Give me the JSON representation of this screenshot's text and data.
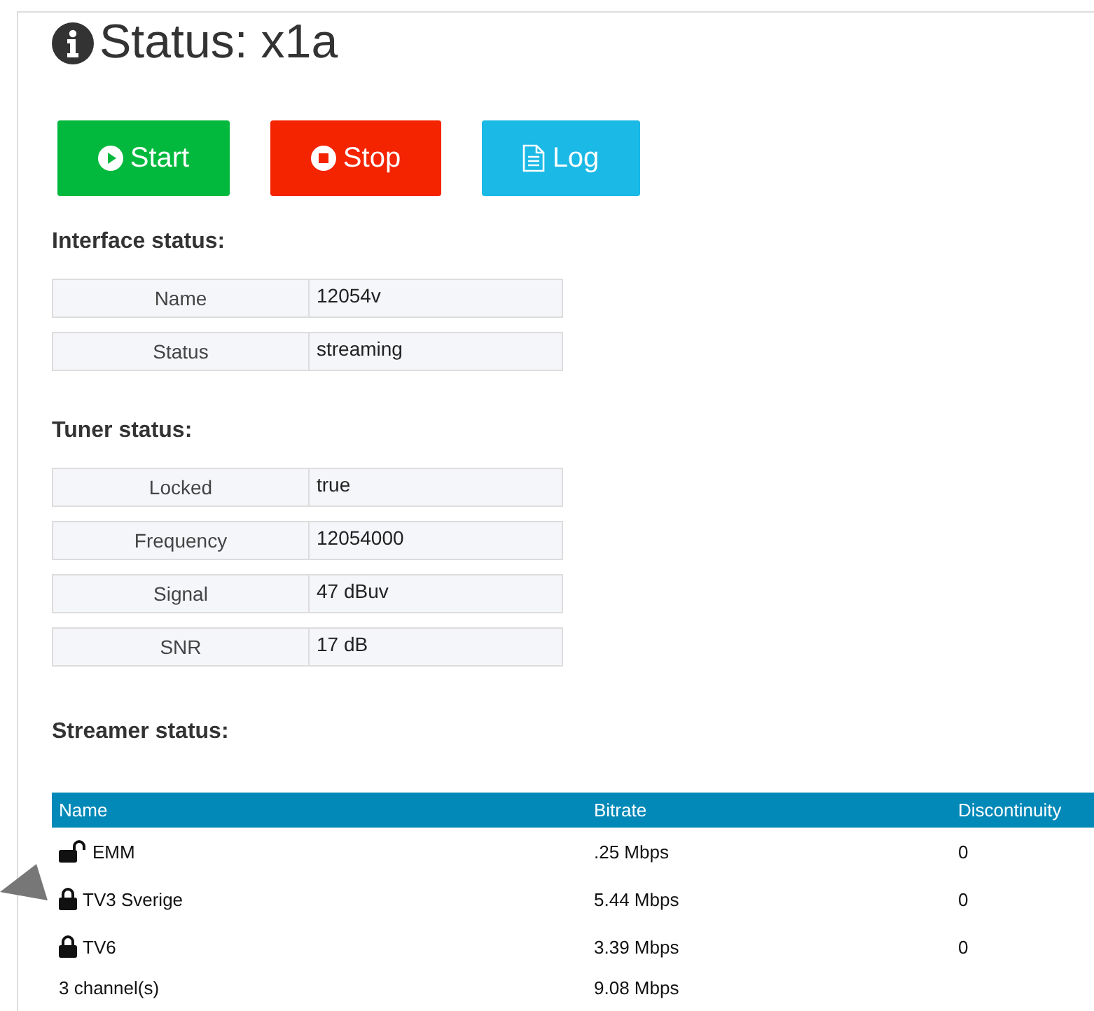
{
  "title": "Status: x1a",
  "buttons": [
    {
      "label": "Start",
      "kind": "start"
    },
    {
      "label": "Stop",
      "kind": "stop"
    },
    {
      "label": "Log",
      "kind": "log"
    }
  ],
  "sections": [
    {
      "heading": "Interface status:",
      "rows": [
        {
          "label": "Name",
          "value": "12054v"
        },
        {
          "label": "Status",
          "value": "streaming"
        }
      ]
    },
    {
      "heading": "Tuner status:",
      "rows": [
        {
          "label": "Locked",
          "value": "true"
        },
        {
          "label": "Frequency",
          "value": "12054000"
        },
        {
          "label": "Signal",
          "value": "47 dBuv"
        },
        {
          "label": "SNR",
          "value": "17 dB"
        }
      ]
    }
  ],
  "streamer": {
    "heading": "Streamer status:",
    "columns": [
      "Name",
      "Bitrate",
      "Discontinuity"
    ],
    "rows": [
      {
        "name": "EMM",
        "locked": false,
        "bitrate": ".25 Mbps",
        "discontinuity": "0"
      },
      {
        "name": "TV3 Sverige",
        "locked": true,
        "bitrate": "5.44 Mbps",
        "discontinuity": "0"
      },
      {
        "name": "TV6",
        "locked": true,
        "bitrate": "3.39 Mbps",
        "discontinuity": "0"
      }
    ],
    "footer": {
      "name": "3 channel(s)",
      "bitrate": "9.08 Mbps"
    }
  }
}
